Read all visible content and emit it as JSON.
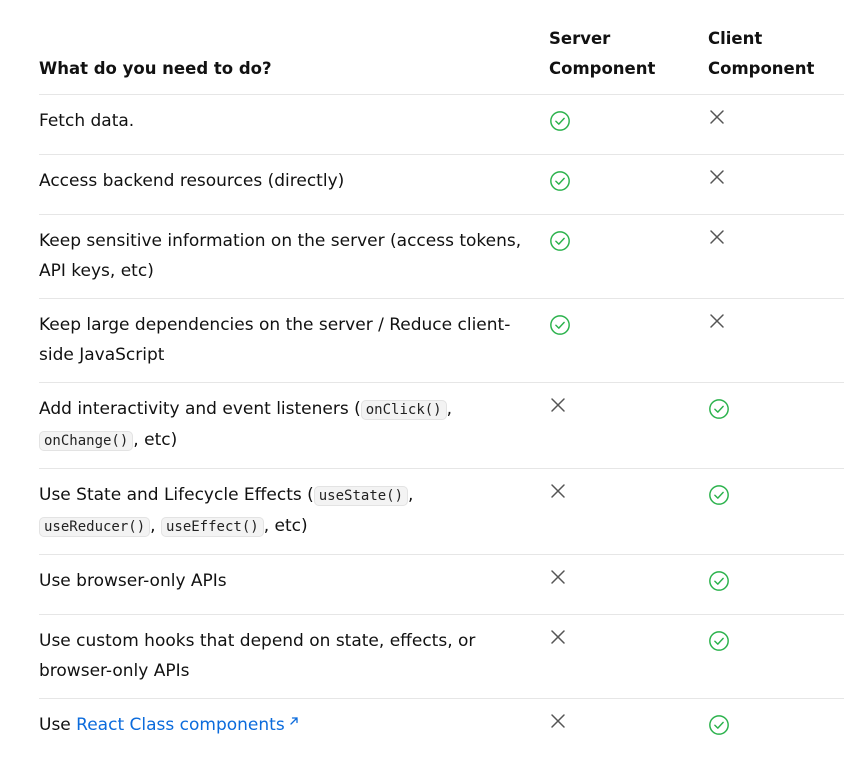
{
  "table": {
    "headers": {
      "feature": "What do you need to do?",
      "server_line1": "Server",
      "server_line2": "Component",
      "client_line1": "Client",
      "client_line2": "Component"
    },
    "rows": [
      {
        "segments": [
          {
            "t": "text",
            "v": "Fetch data."
          }
        ],
        "server": "check",
        "client": "cross"
      },
      {
        "segments": [
          {
            "t": "text",
            "v": "Access backend resources (directly)"
          }
        ],
        "server": "check",
        "client": "cross"
      },
      {
        "segments": [
          {
            "t": "text",
            "v": "Keep sensitive information on the server (access tokens, API keys, etc)"
          }
        ],
        "server": "check",
        "client": "cross"
      },
      {
        "segments": [
          {
            "t": "text",
            "v": "Keep large dependencies on the server / Reduce client-side JavaScript"
          }
        ],
        "server": "check",
        "client": "cross"
      },
      {
        "segments": [
          {
            "t": "text",
            "v": "Add interactivity and event listeners ("
          },
          {
            "t": "code",
            "v": "onClick()"
          },
          {
            "t": "text",
            "v": ", "
          },
          {
            "t": "code",
            "v": "onChange()"
          },
          {
            "t": "text",
            "v": ", etc)"
          }
        ],
        "server": "cross",
        "client": "check"
      },
      {
        "segments": [
          {
            "t": "text",
            "v": "Use State and Lifecycle Effects ("
          },
          {
            "t": "code",
            "v": "useState()"
          },
          {
            "t": "text",
            "v": ", "
          },
          {
            "t": "code",
            "v": "useReducer()"
          },
          {
            "t": "text",
            "v": ", "
          },
          {
            "t": "code",
            "v": "useEffect()"
          },
          {
            "t": "text",
            "v": ", etc)"
          }
        ],
        "server": "cross",
        "client": "check"
      },
      {
        "segments": [
          {
            "t": "text",
            "v": "Use browser-only APIs"
          }
        ],
        "server": "cross",
        "client": "check"
      },
      {
        "segments": [
          {
            "t": "text",
            "v": "Use custom hooks that depend on state, effects, or browser-only APIs"
          }
        ],
        "server": "cross",
        "client": "check"
      },
      {
        "segments": [
          {
            "t": "text",
            "v": "Use "
          },
          {
            "t": "link",
            "v": "React Class components"
          }
        ],
        "server": "cross",
        "client": "check"
      }
    ]
  },
  "icons": {
    "check": "check-circle-icon",
    "cross": "x-mark-icon",
    "external": "external-link-icon"
  },
  "colors": {
    "check": "#2bb24c",
    "cross": "#555555",
    "link": "#0b6bdc"
  }
}
